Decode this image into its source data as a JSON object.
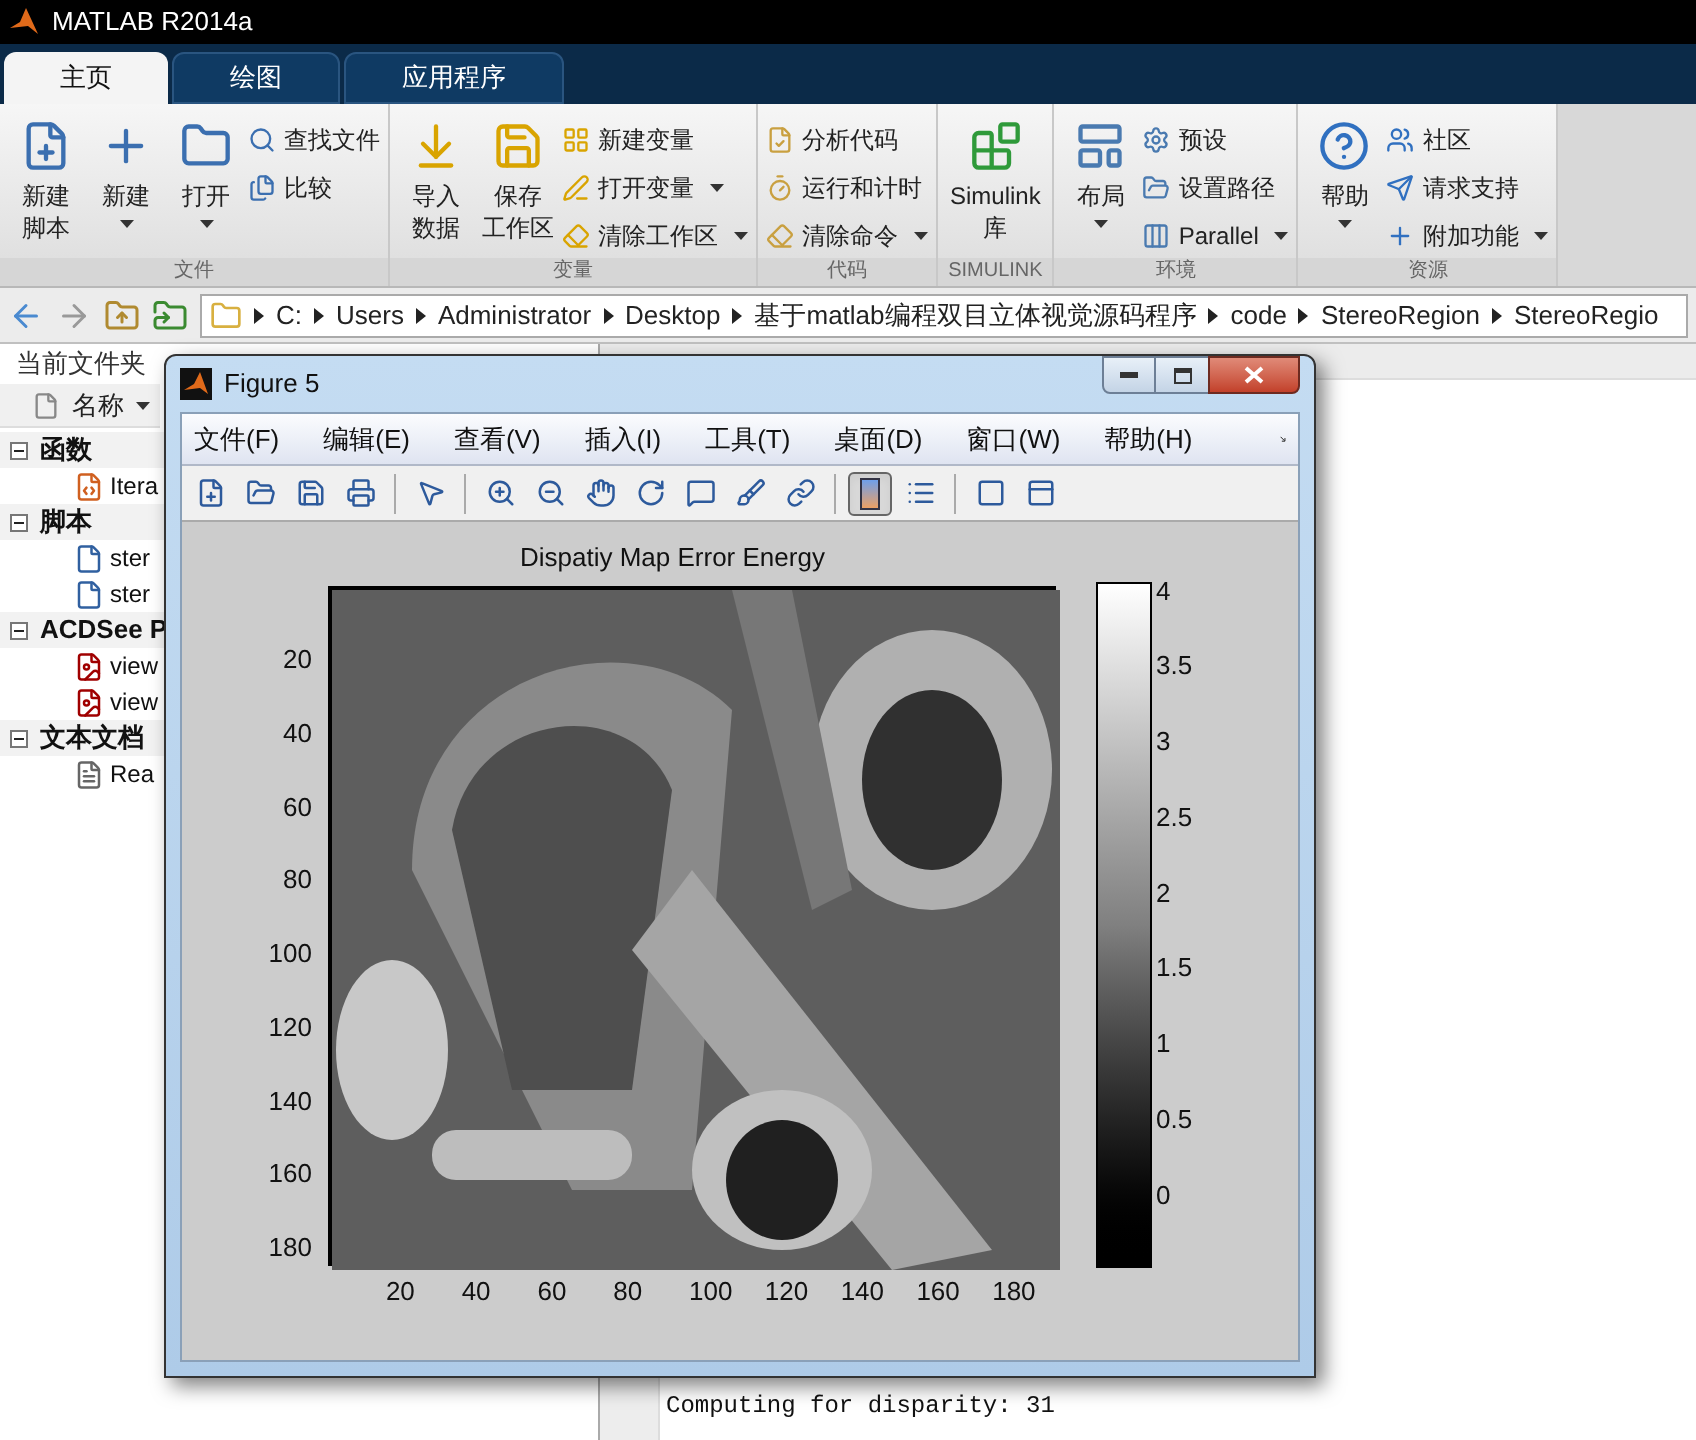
{
  "window": {
    "title": "MATLAB R2014a"
  },
  "tabs": [
    {
      "label": "主页",
      "selected": true
    },
    {
      "label": "绘图",
      "selected": false
    },
    {
      "label": "应用程序",
      "selected": false
    }
  ],
  "ribbon_groups": [
    {
      "label": "文件",
      "large": [
        {
          "lines": [
            "新建",
            "脚本"
          ],
          "dropdown": false
        },
        {
          "lines": [
            "新建"
          ],
          "dropdown": true
        },
        {
          "lines": [
            "打开"
          ],
          "dropdown": true
        }
      ],
      "small": [
        {
          "label": "查找文件",
          "dropdown": false
        },
        {
          "label": "比较",
          "dropdown": false
        }
      ]
    },
    {
      "label": "变量",
      "large": [
        {
          "lines": [
            "导入",
            "数据"
          ],
          "dropdown": false
        },
        {
          "lines": [
            "保存",
            "工作区"
          ],
          "dropdown": false
        }
      ],
      "small": [
        {
          "label": "新建变量",
          "dropdown": false
        },
        {
          "label": "打开变量",
          "dropdown": true
        },
        {
          "label": "清除工作区",
          "dropdown": true
        }
      ]
    },
    {
      "label": "代码",
      "small": [
        {
          "label": "分析代码",
          "dropdown": false
        },
        {
          "label": "运行和计时",
          "dropdown": false
        },
        {
          "label": "清除命令",
          "dropdown": true
        }
      ]
    },
    {
      "label": "SIMULINK",
      "large": [
        {
          "lines": [
            "Simulink",
            "库"
          ],
          "dropdown": false
        }
      ]
    },
    {
      "label": "环境",
      "large": [
        {
          "lines": [
            "布局"
          ],
          "dropdown": true
        }
      ],
      "small": [
        {
          "label": "预设",
          "dropdown": false
        },
        {
          "label": "设置路径",
          "dropdown": false
        },
        {
          "label": "Parallel",
          "dropdown": true
        }
      ]
    },
    {
      "label": "资源",
      "large": [
        {
          "lines": [
            "帮助"
          ],
          "dropdown": true
        }
      ],
      "small": [
        {
          "label": "社区",
          "dropdown": false
        },
        {
          "label": "请求支持",
          "dropdown": false
        },
        {
          "label": "附加功能",
          "dropdown": true
        }
      ]
    }
  ],
  "path": [
    "C:",
    "Users",
    "Administrator",
    "Desktop",
    "基于matlab编程双目立体视觉源码程序",
    "code",
    "StereoRegion",
    "StereoRegio"
  ],
  "file_panel": {
    "title": "当前文件夹",
    "column": "名称",
    "tree": [
      {
        "label": "函数",
        "expanded": true,
        "children": [
          {
            "label": "Itera"
          }
        ]
      },
      {
        "label": "脚本",
        "expanded": true,
        "children": [
          {
            "label": "ster"
          },
          {
            "label": "ster"
          }
        ]
      },
      {
        "label": "ACDSee P",
        "expanded": true,
        "children": [
          {
            "label": "view"
          },
          {
            "label": "view"
          }
        ]
      },
      {
        "label": "文本文档",
        "expanded": true,
        "children": [
          {
            "label": "Rea"
          }
        ]
      }
    ]
  },
  "command_window": {
    "lines": [
      "Computing for disparity: 31"
    ]
  },
  "figure": {
    "title": "Figure 5",
    "menu": [
      "文件(F)",
      "编辑(E)",
      "查看(V)",
      "插入(I)",
      "工具(T)",
      "桌面(D)",
      "窗口(W)",
      "帮助(H)"
    ],
    "toolbar": [
      {
        "selected": false
      },
      {
        "selected": false
      },
      {
        "selected": false
      },
      {
        "selected": false
      },
      {
        "selected": false
      },
      {
        "selected": false
      },
      {
        "selected": false
      },
      {
        "selected": false
      },
      {
        "selected": false
      },
      {
        "selected": false
      },
      {
        "selected": false
      },
      {
        "selected": false
      },
      {
        "selected": true
      },
      {
        "selected": false
      },
      {
        "selected": false
      },
      {
        "selected": false
      }
    ],
    "plot": {
      "title": "Dispatiy Map Error Energy",
      "yticks": [
        "20",
        "40",
        "60",
        "80",
        "100",
        "120",
        "140",
        "160",
        "180"
      ],
      "xticks": [
        "20",
        "40",
        "60",
        "80",
        "100",
        "120",
        "140",
        "160",
        "180"
      ],
      "colorbar_ticks": [
        "4",
        "3.5",
        "3",
        "2.5",
        "2",
        "1.5",
        "1",
        "0.5",
        "0"
      ]
    }
  }
}
